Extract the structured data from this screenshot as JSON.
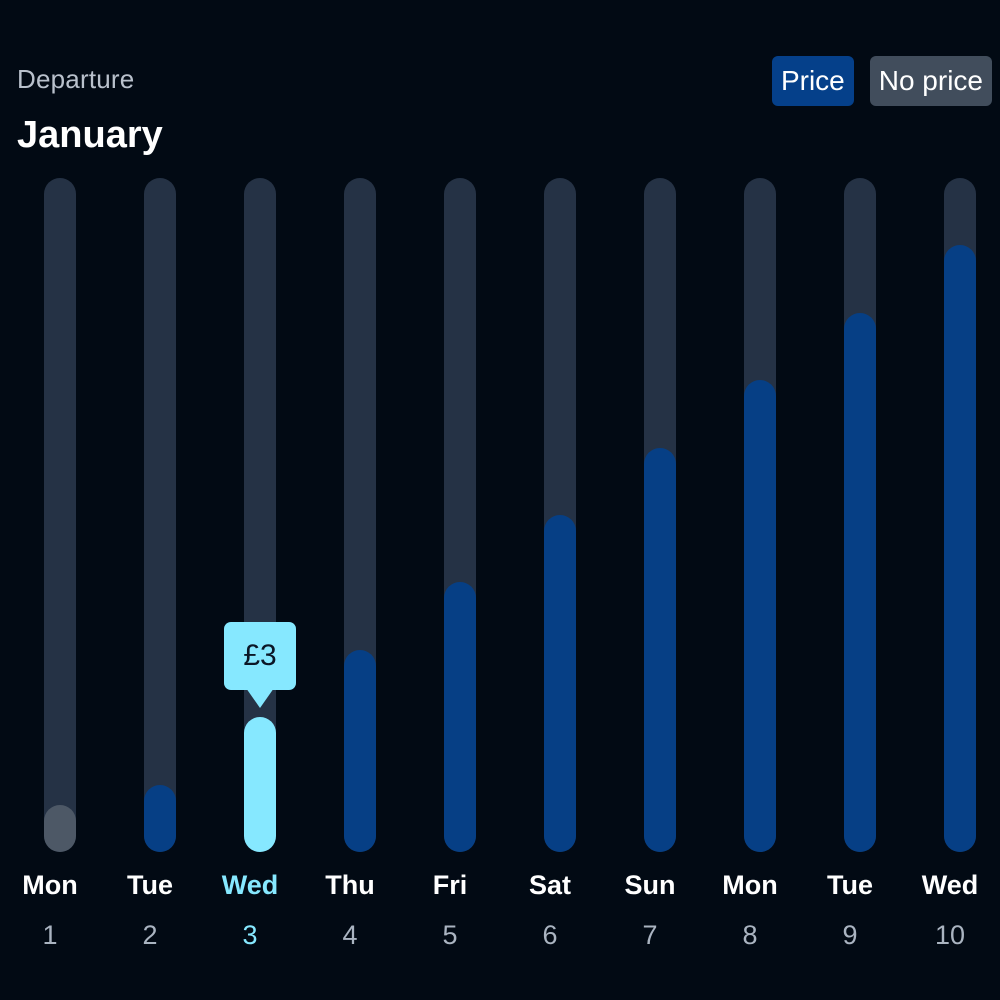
{
  "header": {
    "subtitle": "Departure",
    "title": "January"
  },
  "legend": {
    "price_label": "Price",
    "no_price_label": "No price"
  },
  "colors": {
    "price": "#063f85",
    "no_price": "#4d5866",
    "selected": "#86e8ff",
    "track": "#253245"
  },
  "tooltip": {
    "label": "£3"
  },
  "chart_data": {
    "type": "bar",
    "categories": [
      "Mon 1",
      "Tue 2",
      "Wed 3",
      "Thu 4",
      "Fri 5",
      "Sat 6",
      "Sun 7",
      "Mon 8",
      "Tue 9",
      "Wed 10"
    ],
    "days": [
      {
        "weekday": "Mon",
        "date": "1",
        "level": 0.07,
        "status": "no_price"
      },
      {
        "weekday": "Tue",
        "date": "2",
        "level": 0.1,
        "status": "price"
      },
      {
        "weekday": "Wed",
        "date": "3",
        "level": 0.2,
        "status": "selected"
      },
      {
        "weekday": "Thu",
        "date": "4",
        "level": 0.3,
        "status": "price"
      },
      {
        "weekday": "Fri",
        "date": "5",
        "level": 0.4,
        "status": "price"
      },
      {
        "weekday": "Sat",
        "date": "6",
        "level": 0.5,
        "status": "price"
      },
      {
        "weekday": "Sun",
        "date": "7",
        "level": 0.6,
        "status": "price"
      },
      {
        "weekday": "Mon",
        "date": "8",
        "level": 0.7,
        "status": "price"
      },
      {
        "weekday": "Tue",
        "date": "9",
        "level": 0.8,
        "status": "price"
      },
      {
        "weekday": "Wed",
        "date": "10",
        "level": 0.9,
        "status": "price"
      }
    ],
    "selected_index": 2
  }
}
